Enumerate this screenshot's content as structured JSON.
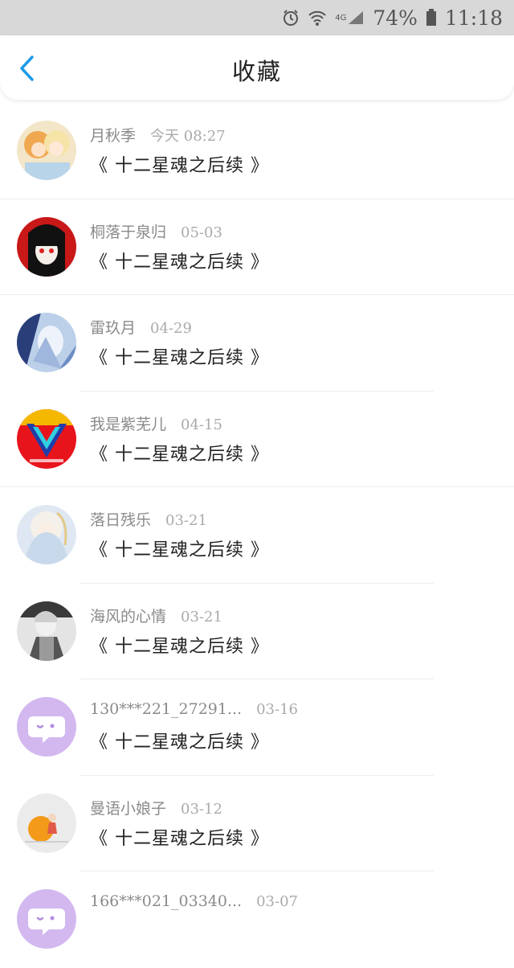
{
  "status_bar": {
    "battery": "74%",
    "time": "11:18",
    "network": "4G",
    "icons": [
      "alarm-icon",
      "wifi-icon",
      "signal-icon",
      "battery-icon"
    ]
  },
  "header": {
    "title": "收藏",
    "back_icon": "chevron-left-icon",
    "accent": "#1e9be8"
  },
  "favorites": [
    {
      "user": "月秋季",
      "time": "今天 08:27",
      "work": "《 十二星魂之后续 》",
      "avatar": "anime-avatar"
    },
    {
      "user": "桐落于泉归",
      "time": "05-03",
      "work": "《 十二星魂之后续 》",
      "avatar": "anime-avatar"
    },
    {
      "user": "雷玖月",
      "time": "04-29",
      "work": "《 十二星魂之后续 》",
      "avatar": "anime-avatar"
    },
    {
      "user": "我是紫芜儿",
      "time": "04-15",
      "work": "《 十二星魂之后续 》",
      "avatar": "logo-avatar"
    },
    {
      "user": "落日残乐",
      "time": "03-21",
      "work": "《 十二星魂之后续 》",
      "avatar": "anime-avatar"
    },
    {
      "user": "海风的心情",
      "time": "03-21",
      "work": "《 十二星魂之后续 》",
      "avatar": "anime-avatar"
    },
    {
      "user": "130***221_27291...",
      "time": "03-16",
      "work": "《 十二星魂之后续 》",
      "avatar": "default-chat-avatar"
    },
    {
      "user": "曼语小娘子",
      "time": "03-12",
      "work": "《 十二星魂之后续 》",
      "avatar": "cartoon-avatar"
    },
    {
      "user": "166***021_03340...",
      "time": "03-07",
      "work": "",
      "avatar": "default-chat-avatar"
    }
  ]
}
